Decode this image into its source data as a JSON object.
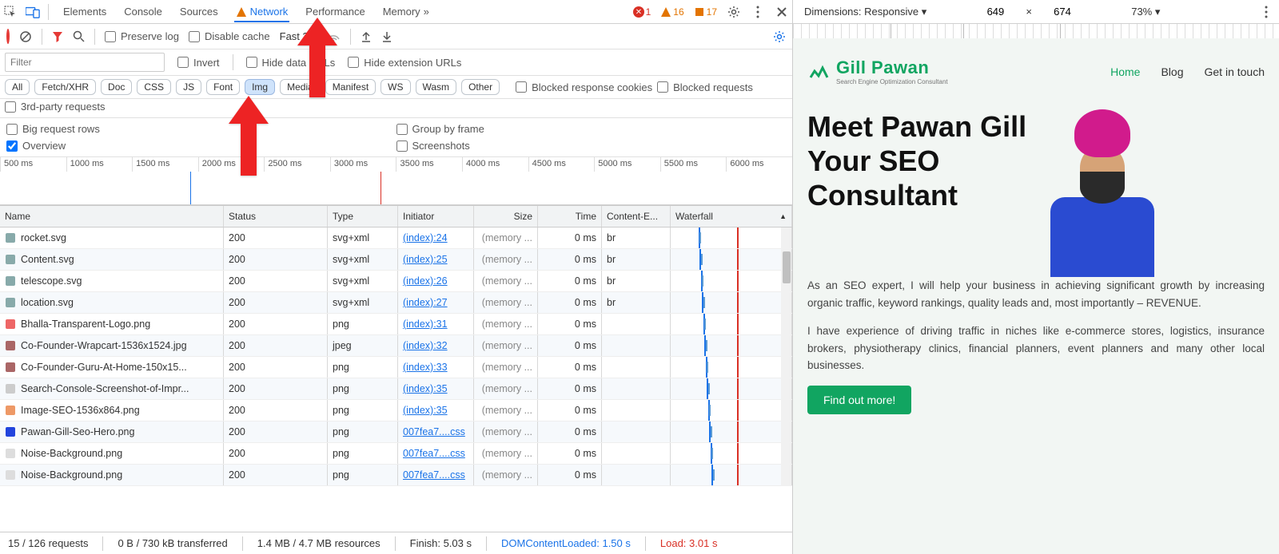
{
  "topbar": {
    "tabs": [
      "Elements",
      "Console",
      "Sources",
      "Network",
      "Performance",
      "Memory"
    ],
    "active_tab": "Network",
    "overflow": "»",
    "errors": "1",
    "warnings": "16",
    "issues": "17"
  },
  "net_toolbar": {
    "preserve_log": "Preserve log",
    "disable_cache": "Disable cache",
    "throttle": "Fast 3G"
  },
  "filter_row": {
    "filter_placeholder": "Filter",
    "invert": "Invert",
    "hide_data": "Hide data URLs",
    "hide_ext": "Hide extension URLs"
  },
  "type_chips": [
    "All",
    "Fetch/XHR",
    "Doc",
    "CSS",
    "JS",
    "Font",
    "Img",
    "Media",
    "Manifest",
    "WS",
    "Wasm",
    "Other"
  ],
  "type_active": "Img",
  "type_checks": {
    "blocked_cookies": "Blocked response cookies",
    "blocked_requests": "Blocked requests",
    "third_party": "3rd-party requests"
  },
  "options": {
    "big_rows": "Big request rows",
    "overview": "Overview",
    "group_frame": "Group by frame",
    "screenshots": "Screenshots"
  },
  "timeline_ticks": [
    "500 ms",
    "1000 ms",
    "1500 ms",
    "2000 ms",
    "2500 ms",
    "3000 ms",
    "3500 ms",
    "4000 ms",
    "4500 ms",
    "5000 ms",
    "5500 ms",
    "6000 ms"
  ],
  "columns": [
    "Name",
    "Status",
    "Type",
    "Initiator",
    "Size",
    "Time",
    "Content-E...",
    "Waterfall"
  ],
  "rows": [
    {
      "icon": "#8aa",
      "name": "rocket.svg",
      "status": "200",
      "type": "svg+xml",
      "initiator": "(index):24",
      "size": "(memory ...",
      "time": "0 ms",
      "enc": "br",
      "bar": 23
    },
    {
      "icon": "#8aa",
      "name": "Content.svg",
      "status": "200",
      "type": "svg+xml",
      "initiator": "(index):25",
      "size": "(memory ...",
      "time": "0 ms",
      "enc": "br",
      "bar": 24
    },
    {
      "icon": "#8aa",
      "name": "telescope.svg",
      "status": "200",
      "type": "svg+xml",
      "initiator": "(index):26",
      "size": "(memory ...",
      "time": "0 ms",
      "enc": "br",
      "bar": 25
    },
    {
      "icon": "#8aa",
      "name": "location.svg",
      "status": "200",
      "type": "svg+xml",
      "initiator": "(index):27",
      "size": "(memory ...",
      "time": "0 ms",
      "enc": "br",
      "bar": 26
    },
    {
      "icon": "#e66",
      "name": "Bhalla-Transparent-Logo.png",
      "status": "200",
      "type": "png",
      "initiator": "(index):31",
      "size": "(memory ...",
      "time": "0 ms",
      "enc": "",
      "bar": 27
    },
    {
      "icon": "#a66",
      "name": "Co-Founder-Wrapcart-1536x1524.jpg",
      "status": "200",
      "type": "jpeg",
      "initiator": "(index):32",
      "size": "(memory ...",
      "time": "0 ms",
      "enc": "",
      "bar": 28
    },
    {
      "icon": "#a66",
      "name": "Co-Founder-Guru-At-Home-150x15...",
      "status": "200",
      "type": "png",
      "initiator": "(index):33",
      "size": "(memory ...",
      "time": "0 ms",
      "enc": "",
      "bar": 29
    },
    {
      "icon": "#ccc",
      "name": "Search-Console-Screenshot-of-Impr...",
      "status": "200",
      "type": "png",
      "initiator": "(index):35",
      "size": "(memory ...",
      "time": "0 ms",
      "enc": "",
      "bar": 30
    },
    {
      "icon": "#e96",
      "name": "Image-SEO-1536x864.png",
      "status": "200",
      "type": "png",
      "initiator": "(index):35",
      "size": "(memory ...",
      "time": "0 ms",
      "enc": "",
      "bar": 31
    },
    {
      "icon": "#24d",
      "name": "Pawan-Gill-Seo-Hero.png",
      "status": "200",
      "type": "png",
      "initiator": "007fea7....css",
      "size": "(memory ...",
      "time": "0 ms",
      "enc": "",
      "bar": 32
    },
    {
      "icon": "#ddd",
      "name": "Noise-Background.png",
      "status": "200",
      "type": "png",
      "initiator": "007fea7....css",
      "size": "(memory ...",
      "time": "0 ms",
      "enc": "",
      "bar": 33
    },
    {
      "icon": "#ddd",
      "name": "Noise-Background.png",
      "status": "200",
      "type": "png",
      "initiator": "007fea7....css",
      "size": "(memory ...",
      "time": "0 ms",
      "enc": "",
      "bar": 34
    }
  ],
  "statusbar": {
    "requests": "15 / 126 requests",
    "transferred": "0 B / 730 kB transferred",
    "resources": "1.4 MB / 4.7 MB resources",
    "finish": "Finish: 5.03 s",
    "dom": "DOMContentLoaded: 1.50 s",
    "load": "Load: 3.01 s"
  },
  "preview_bar": {
    "dimensions_label": "Dimensions: Responsive",
    "w": "649",
    "x": "×",
    "h": "674",
    "zoom": "73%"
  },
  "site": {
    "brand_name": "Gill Pawan",
    "brand_sub": "Search Engine Optimization Consultant",
    "nav": {
      "home": "Home",
      "blog": "Blog",
      "contact": "Get in touch"
    },
    "hero_l1": "Meet Pawan Gill",
    "hero_l2": "Your SEO",
    "hero_l3": "Consultant",
    "p1": "As an SEO expert, I will help your business in achieving significant growth by increasing organic traffic, keyword rankings, quality leads and, most importantly – REVENUE.",
    "p2": "I have experience of driving traffic in niches like e-commerce stores, logistics, insurance brokers, physiotherapy clinics, financial planners, event planners and many other local businesses.",
    "cta": "Find out more!"
  }
}
